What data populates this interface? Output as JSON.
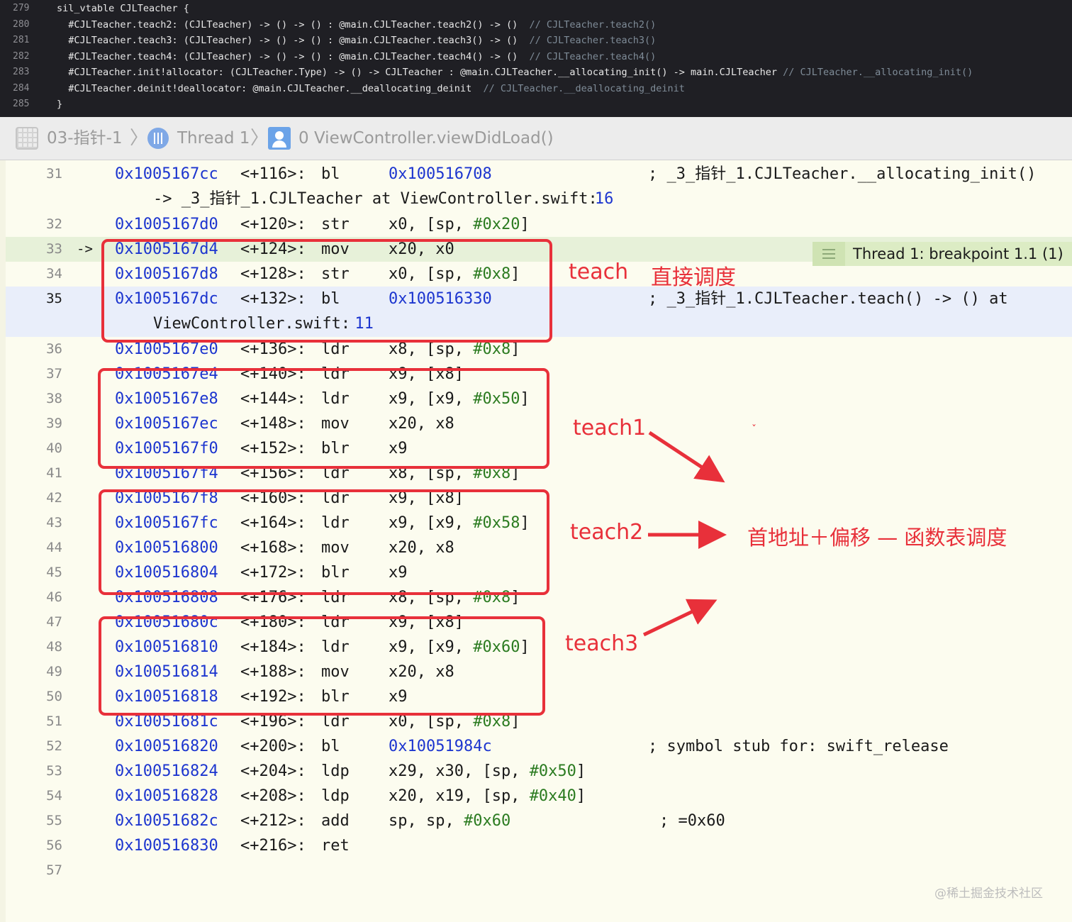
{
  "sil_vtable": {
    "lines": [
      {
        "num": "279",
        "code": "sil_vtable CJLTeacher {",
        "comment": ""
      },
      {
        "num": "280",
        "code": "  #CJLTeacher.teach2: (CJLTeacher) -> () -> () : @main.CJLTeacher.teach2() -> ()  ",
        "comment": "// CJLTeacher.teach2()"
      },
      {
        "num": "281",
        "code": "  #CJLTeacher.teach3: (CJLTeacher) -> () -> () : @main.CJLTeacher.teach3() -> ()  ",
        "comment": "// CJLTeacher.teach3()"
      },
      {
        "num": "282",
        "code": "  #CJLTeacher.teach4: (CJLTeacher) -> () -> () : @main.CJLTeacher.teach4() -> ()  ",
        "comment": "// CJLTeacher.teach4()"
      },
      {
        "num": "283",
        "code": "  #CJLTeacher.init!allocator: (CJLTeacher.Type) -> () -> CJLTeacher : @main.CJLTeacher.__allocating_init() -> main.CJLTeacher ",
        "comment": "// CJLTeacher.__allocating_init()"
      },
      {
        "num": "284",
        "code": "  #CJLTeacher.deinit!deallocator: @main.CJLTeacher.__deallocating_deinit  ",
        "comment": "// CJLTeacher.__deallocating_deinit"
      },
      {
        "num": "285",
        "code": "}",
        "comment": ""
      }
    ]
  },
  "jump_bar": {
    "project": "03-指针-1",
    "thread": "Thread 1",
    "frame": "0 ViewController.viewDidLoad()",
    "separator": "〉"
  },
  "breakpoint": {
    "label": "Thread 1: breakpoint 1.1 (1)",
    "pc_marker": "->"
  },
  "disassembly": [
    {
      "num": "31",
      "addr": "0x1005167cc",
      "off": "<+116>:",
      "mn": "bl",
      "ops": [
        {
          "t": "0x100516708",
          "c": "num"
        }
      ],
      "comment": "; _3_指针_1.CJLTeacher.__allocating_init()"
    },
    {
      "cont": "-> _3_指针_1.CJLTeacher at ViewController.swift:",
      "cont_num": "16"
    },
    {
      "num": "32",
      "addr": "0x1005167d0",
      "off": "<+120>:",
      "mn": "str",
      "ops": [
        {
          "t": "x0, [sp, "
        },
        {
          "t": "#0x20",
          "c": "imm"
        },
        {
          "t": "]"
        }
      ]
    },
    {
      "num": "33",
      "addr": "0x1005167d4",
      "off": "<+124>:",
      "mn": "mov",
      "ops": [
        {
          "t": "x20, x0"
        }
      ],
      "hl": "green",
      "pc": true
    },
    {
      "num": "34",
      "addr": "0x1005167d8",
      "off": "<+128>:",
      "mn": "str",
      "ops": [
        {
          "t": "x0, [sp, "
        },
        {
          "t": "#0x8",
          "c": "imm"
        },
        {
          "t": "]"
        }
      ]
    },
    {
      "num": "35",
      "addr": "0x1005167dc",
      "off": "<+132>:",
      "mn": "bl",
      "ops": [
        {
          "t": "0x100516330",
          "c": "num"
        }
      ],
      "comment": "; _3_指针_1.CJLTeacher.teach() -> () at",
      "hl": "blue",
      "cur": true
    },
    {
      "cont": "ViewController.swift:",
      "cont_num": "11",
      "hl": "blue"
    },
    {
      "num": "36",
      "addr": "0x1005167e0",
      "off": "<+136>:",
      "mn": "ldr",
      "ops": [
        {
          "t": "x8, [sp, "
        },
        {
          "t": "#0x8",
          "c": "imm"
        },
        {
          "t": "]"
        }
      ]
    },
    {
      "num": "37",
      "addr": "0x1005167e4",
      "off": "<+140>:",
      "mn": "ldr",
      "ops": [
        {
          "t": "x9, [x8]"
        }
      ]
    },
    {
      "num": "38",
      "addr": "0x1005167e8",
      "off": "<+144>:",
      "mn": "ldr",
      "ops": [
        {
          "t": "x9, [x9, "
        },
        {
          "t": "#0x50",
          "c": "imm"
        },
        {
          "t": "]"
        }
      ]
    },
    {
      "num": "39",
      "addr": "0x1005167ec",
      "off": "<+148>:",
      "mn": "mov",
      "ops": [
        {
          "t": "x20, x8"
        }
      ]
    },
    {
      "num": "40",
      "addr": "0x1005167f0",
      "off": "<+152>:",
      "mn": "blr",
      "ops": [
        {
          "t": "x9"
        }
      ]
    },
    {
      "num": "41",
      "addr": "0x1005167f4",
      "off": "<+156>:",
      "mn": "ldr",
      "ops": [
        {
          "t": "x8, [sp, "
        },
        {
          "t": "#0x8",
          "c": "imm"
        },
        {
          "t": "]"
        }
      ]
    },
    {
      "num": "42",
      "addr": "0x1005167f8",
      "off": "<+160>:",
      "mn": "ldr",
      "ops": [
        {
          "t": "x9, [x8]"
        }
      ]
    },
    {
      "num": "43",
      "addr": "0x1005167fc",
      "off": "<+164>:",
      "mn": "ldr",
      "ops": [
        {
          "t": "x9, [x9, "
        },
        {
          "t": "#0x58",
          "c": "imm"
        },
        {
          "t": "]"
        }
      ]
    },
    {
      "num": "44",
      "addr": "0x100516800",
      "off": "<+168>:",
      "mn": "mov",
      "ops": [
        {
          "t": "x20, x8"
        }
      ]
    },
    {
      "num": "45",
      "addr": "0x100516804",
      "off": "<+172>:",
      "mn": "blr",
      "ops": [
        {
          "t": "x9"
        }
      ]
    },
    {
      "num": "46",
      "addr": "0x100516808",
      "off": "<+176>:",
      "mn": "ldr",
      "ops": [
        {
          "t": "x8, [sp, "
        },
        {
          "t": "#0x8",
          "c": "imm"
        },
        {
          "t": "]"
        }
      ]
    },
    {
      "num": "47",
      "addr": "0x10051680c",
      "off": "<+180>:",
      "mn": "ldr",
      "ops": [
        {
          "t": "x9, [x8]"
        }
      ]
    },
    {
      "num": "48",
      "addr": "0x100516810",
      "off": "<+184>:",
      "mn": "ldr",
      "ops": [
        {
          "t": "x9, [x9, "
        },
        {
          "t": "#0x60",
          "c": "imm"
        },
        {
          "t": "]"
        }
      ]
    },
    {
      "num": "49",
      "addr": "0x100516814",
      "off": "<+188>:",
      "mn": "mov",
      "ops": [
        {
          "t": "x20, x8"
        }
      ]
    },
    {
      "num": "50",
      "addr": "0x100516818",
      "off": "<+192>:",
      "mn": "blr",
      "ops": [
        {
          "t": "x9"
        }
      ]
    },
    {
      "num": "51",
      "addr": "0x10051681c",
      "off": "<+196>:",
      "mn": "ldr",
      "ops": [
        {
          "t": "x0, [sp, "
        },
        {
          "t": "#0x8",
          "c": "imm"
        },
        {
          "t": "]"
        }
      ]
    },
    {
      "num": "52",
      "addr": "0x100516820",
      "off": "<+200>:",
      "mn": "bl",
      "ops": [
        {
          "t": "0x10051984c",
          "c": "num"
        }
      ],
      "comment": "; symbol stub for: swift_release"
    },
    {
      "num": "53",
      "addr": "0x100516824",
      "off": "<+204>:",
      "mn": "ldp",
      "ops": [
        {
          "t": "x29, x30, [sp, "
        },
        {
          "t": "#0x50",
          "c": "imm"
        },
        {
          "t": "]"
        }
      ]
    },
    {
      "num": "54",
      "addr": "0x100516828",
      "off": "<+208>:",
      "mn": "ldp",
      "ops": [
        {
          "t": "x20, x19, [sp, "
        },
        {
          "t": "#0x40",
          "c": "imm"
        },
        {
          "t": "]"
        }
      ]
    },
    {
      "num": "55",
      "addr": "0x10051682c",
      "off": "<+212>:",
      "mn": "add",
      "ops": [
        {
          "t": "sp, sp, "
        },
        {
          "t": "#0x60",
          "c": "imm"
        }
      ],
      "comment2": "; =0x60"
    },
    {
      "num": "56",
      "addr": "0x100516830",
      "off": "<+216>:",
      "mn": "ret",
      "ops": []
    },
    {
      "num": "57"
    }
  ],
  "annotations": {
    "teach": "teach",
    "direct": "直接调度",
    "teach1": "teach1",
    "teach2": "teach2",
    "teach3": "teach3",
    "vtable_note": "首地址＋偏移 — 函数表调度",
    "small_mark": "ˇ"
  },
  "watermark": "@稀土掘金技术社区",
  "colors": {
    "annotation_red": "#e8303a",
    "address_blue": "#1c35cf",
    "immediate_green": "#2b7b20",
    "pc_line_bg": "#e7f1d9",
    "current_line_bg": "#e9eefa",
    "editor_bg": "#fcfcef",
    "top_pane_bg": "#1f1f24"
  },
  "icons": [
    "project-grid-icon",
    "thread-icon",
    "stack-frame-icon",
    "breakpoint-lines-icon"
  ]
}
